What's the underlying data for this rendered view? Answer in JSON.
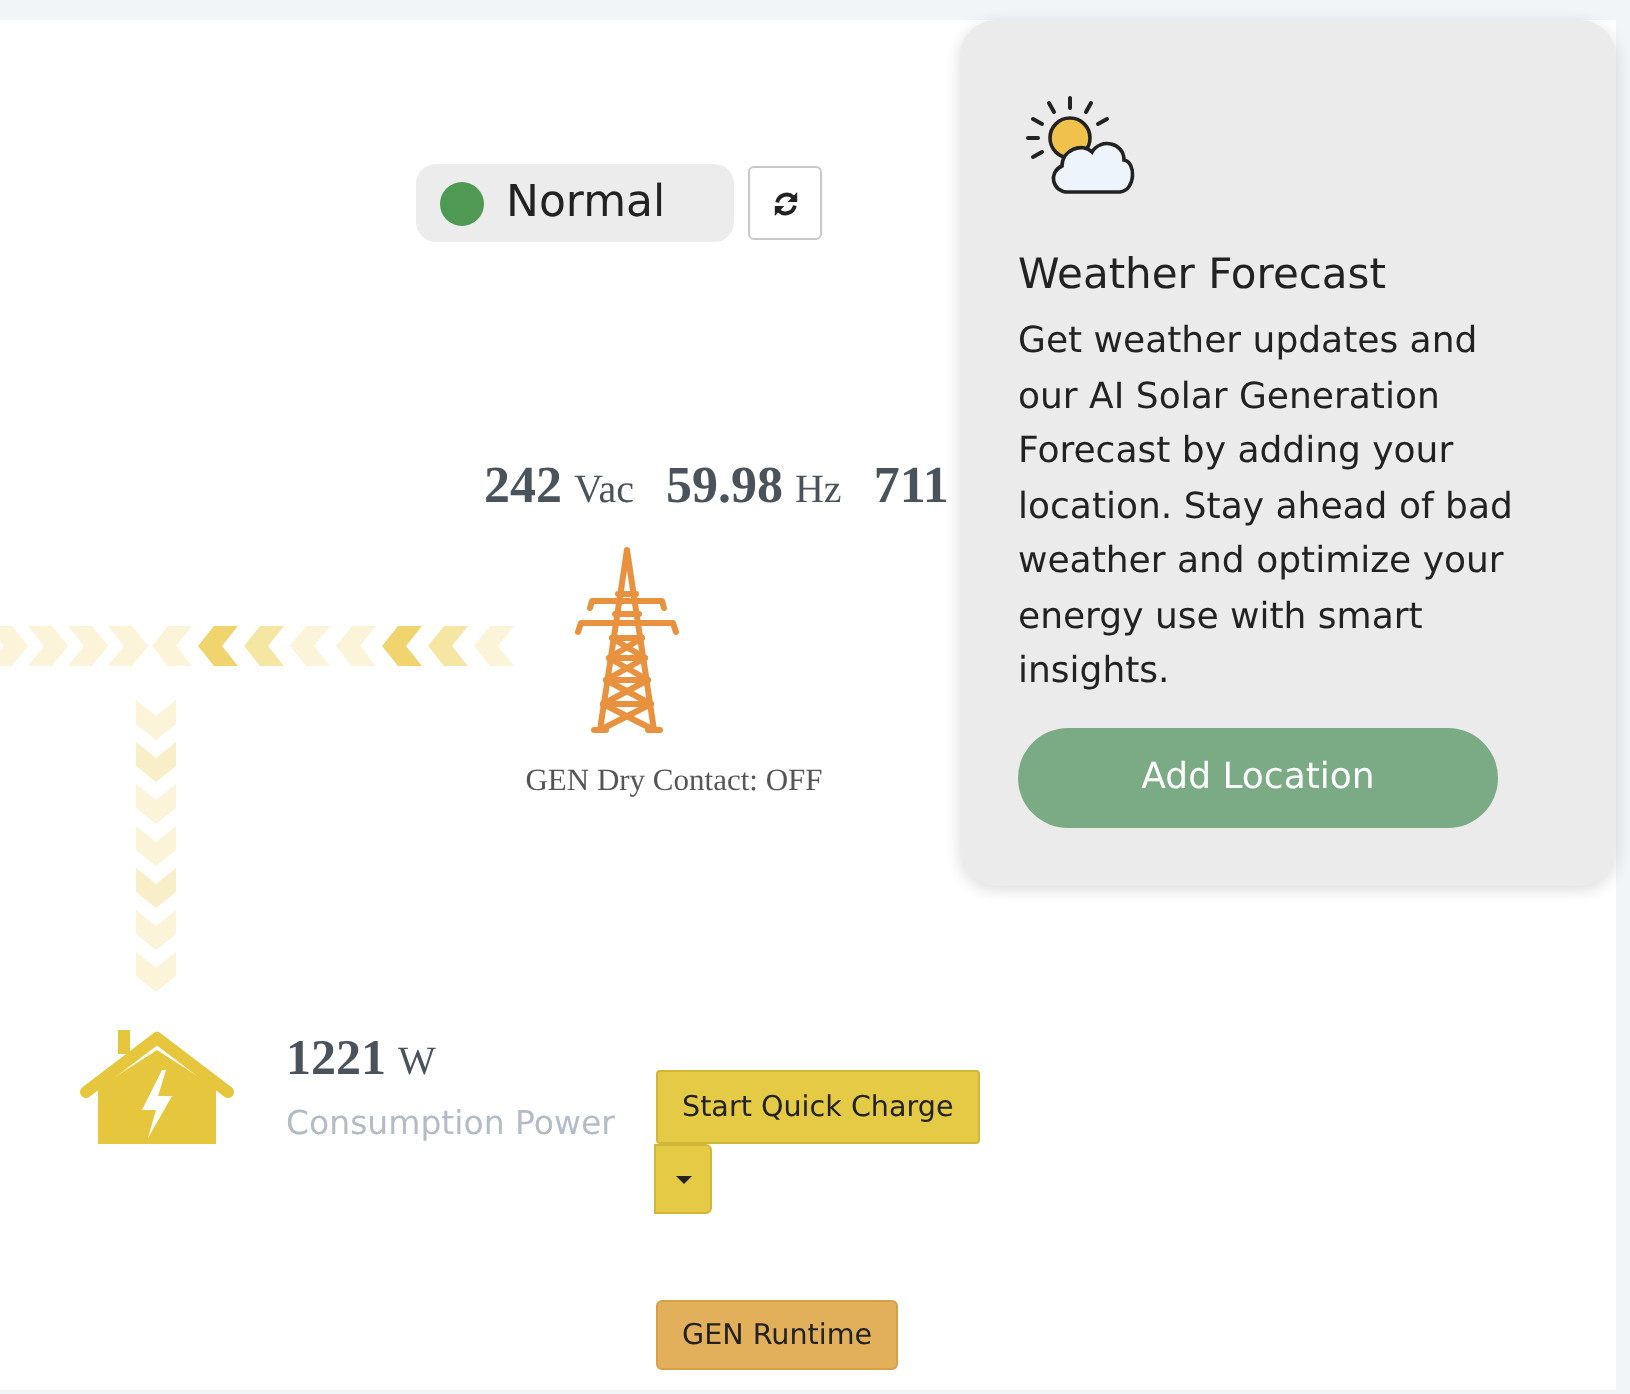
{
  "status": {
    "label": "Normal",
    "color": "#4e9a52"
  },
  "grid": {
    "readings": [
      {
        "value": "242",
        "unit": "Vac"
      },
      {
        "value": "59.98",
        "unit": "Hz"
      },
      {
        "value": "711"
      }
    ],
    "dry_contact": "GEN Dry Contact: OFF"
  },
  "consumption": {
    "value": "1221",
    "unit": "W",
    "label": "Consumption Power"
  },
  "actions": [
    {
      "kind": "split",
      "label": "Start Quick Charge",
      "color": "#e5cb45"
    },
    {
      "kind": "plain",
      "label": "GEN Runtime",
      "color": "#e2b05b"
    }
  ],
  "weather_card": {
    "title": "Weather Forecast",
    "text": "Get weather updates and our AI Solar Generation Forecast by adding your location. Stay ahead of bad weather and optimize your energy use with smart insights.",
    "button": "Add Location"
  }
}
